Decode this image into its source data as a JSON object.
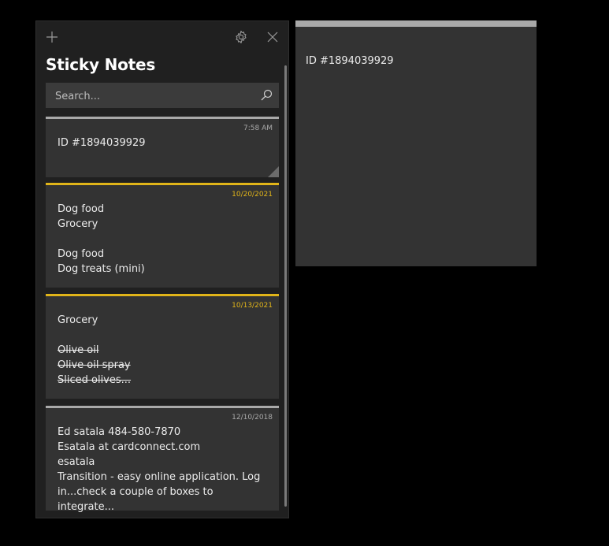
{
  "app": {
    "title": "Sticky Notes",
    "search_placeholder": "Search...",
    "icons": {
      "add": "plus-icon",
      "settings": "gear-icon",
      "close": "close-icon",
      "search": "search-icon"
    }
  },
  "notes": [
    {
      "date": "7:58 AM",
      "color": "#a9a9a9",
      "date_color": "#a9a9a9",
      "lines": [
        "ID #1894039929"
      ]
    },
    {
      "date": "10/20/2021",
      "color": "#e0b419",
      "date_color": "#e0b419",
      "lines": [
        "Dog food",
        "Grocery",
        "",
        "Dog food",
        "Dog treats (mini)"
      ]
    },
    {
      "date": "10/13/2021",
      "color": "#e0b419",
      "date_color": "#e0b419",
      "lines": [
        "Grocery",
        "",
        "Olive oil",
        "Olive oil spray",
        "Sliced olives..."
      ]
    },
    {
      "date": "12/10/2018",
      "color": "#a9a9a9",
      "date_color": "#a9a9a9",
      "lines": [
        "Ed satala 484-580-7870",
        "Esatala at cardconnect.com",
        "esatala",
        "Transition - easy online application. Log in...check a couple of boxes to integrate..."
      ]
    }
  ],
  "open_note": {
    "text": "ID #1894039929",
    "color": "#a9a9a9"
  }
}
